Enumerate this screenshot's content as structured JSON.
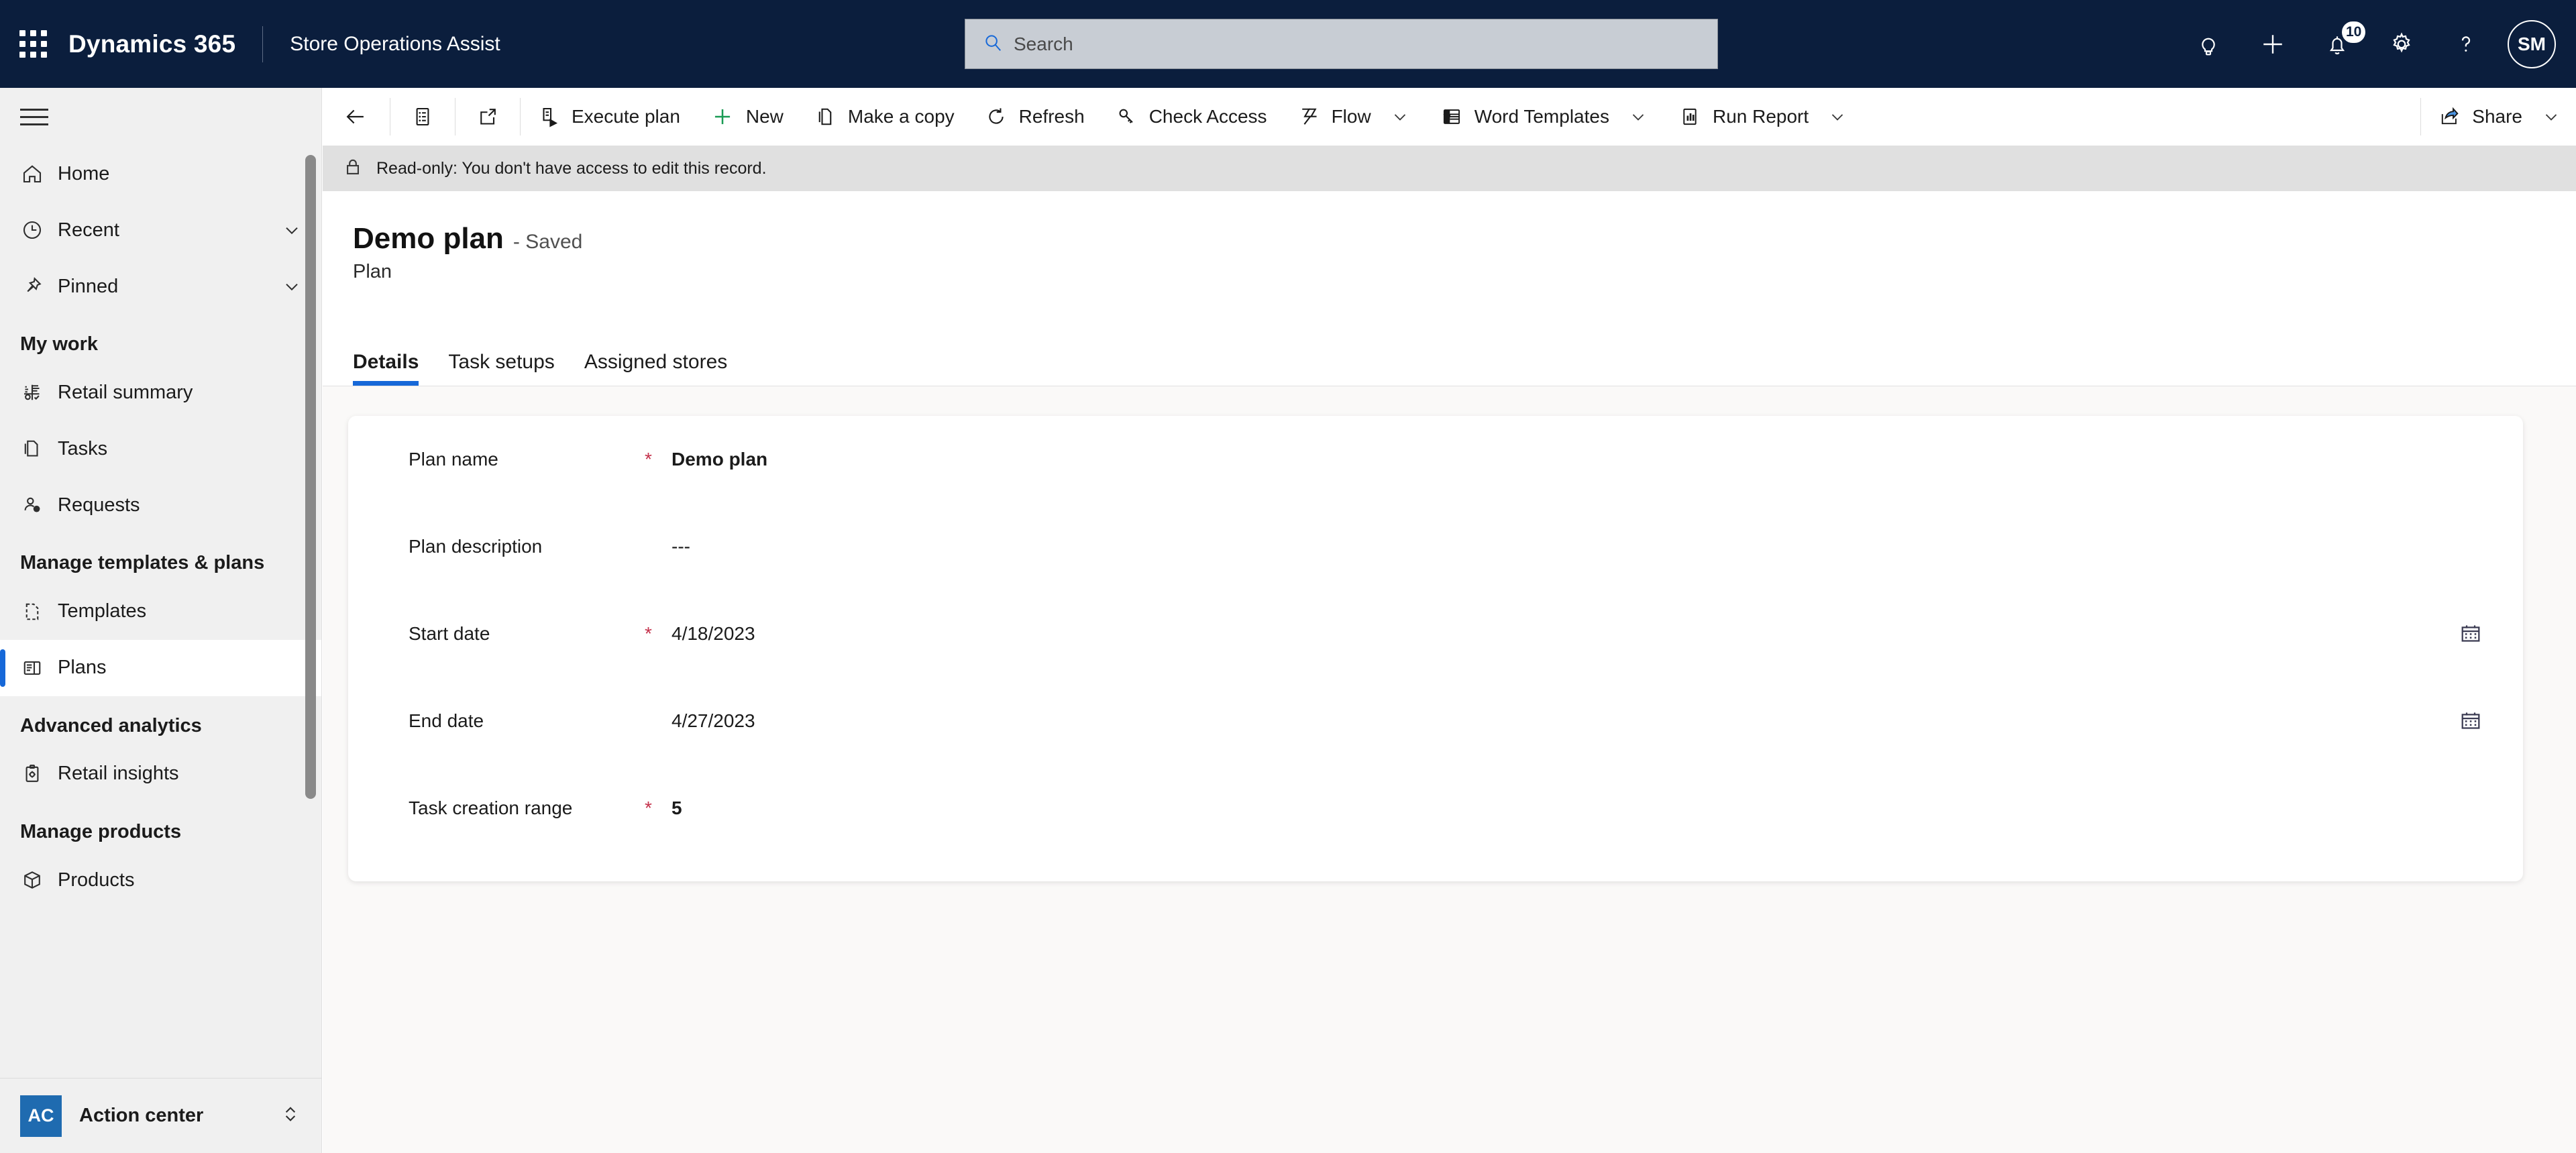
{
  "header": {
    "waffle_icon": "app-launcher-icon",
    "brand": "Dynamics 365",
    "app": "Store Operations Assist",
    "search": {
      "placeholder": "Search",
      "value": "",
      "icon": "search-icon"
    },
    "right_icons": [
      {
        "name": "lightbulb-icon",
        "label": ""
      },
      {
        "name": "add-icon",
        "label": ""
      },
      {
        "name": "notifications-bell-icon",
        "label": "",
        "badge": "10"
      },
      {
        "name": "settings-gear-icon",
        "label": ""
      },
      {
        "name": "help-question-icon",
        "label": ""
      }
    ],
    "avatar_initials": "SM",
    "colors": {
      "header_bg": "#0b1e3d",
      "accent": "#1668d8"
    }
  },
  "sidebar": {
    "hamburger_icon": "hamburger-menu-icon",
    "items": [
      {
        "type": "item",
        "label": "Home",
        "icon": "home-icon",
        "chevron": false,
        "selected": false
      },
      {
        "type": "item",
        "label": "Recent",
        "icon": "clock-icon",
        "chevron": true,
        "selected": false
      },
      {
        "type": "item",
        "label": "Pinned",
        "icon": "pin-icon",
        "chevron": true,
        "selected": false
      },
      {
        "type": "group",
        "label": "My work"
      },
      {
        "type": "item",
        "label": "Retail summary",
        "icon": "chart-summary-icon",
        "chevron": false,
        "selected": false
      },
      {
        "type": "item",
        "label": "Tasks",
        "icon": "documents-icon",
        "chevron": false,
        "selected": false
      },
      {
        "type": "item",
        "label": "Requests",
        "icon": "person-question-icon",
        "chevron": false,
        "selected": false
      },
      {
        "type": "group",
        "label": "Manage templates & plans"
      },
      {
        "type": "item",
        "label": "Templates",
        "icon": "template-page-icon",
        "chevron": false,
        "selected": false
      },
      {
        "type": "item",
        "label": "Plans",
        "icon": "plans-layout-icon",
        "chevron": false,
        "selected": true
      },
      {
        "type": "group",
        "label": "Advanced analytics"
      },
      {
        "type": "item",
        "label": "Retail insights",
        "icon": "clipboard-gear-icon",
        "chevron": false,
        "selected": false
      },
      {
        "type": "group",
        "label": "Manage products"
      },
      {
        "type": "item",
        "label": "Products",
        "icon": "box-package-icon",
        "chevron": false,
        "selected": false
      }
    ],
    "footer": {
      "badge": "AC",
      "label": "Action center",
      "chevron_icon": "chevron-up-down-icon"
    }
  },
  "command_bar": {
    "back_icon": "back-arrow-icon",
    "form_selector_icon": "form-list-icon",
    "popout_icon": "open-in-new-window-icon",
    "buttons": [
      {
        "label": "Execute plan",
        "icon": "execute-plan-icon",
        "chevron": false
      },
      {
        "label": "New",
        "icon": "add-green-icon",
        "chevron": false
      },
      {
        "label": "Make a copy",
        "icon": "copy-icon",
        "chevron": false
      },
      {
        "label": "Refresh",
        "icon": "refresh-icon",
        "chevron": false
      },
      {
        "label": "Check Access",
        "icon": "key-icon",
        "chevron": false
      },
      {
        "label": "Flow",
        "icon": "flow-icon",
        "chevron": true
      },
      {
        "label": "Word Templates",
        "icon": "word-icon",
        "chevron": true
      },
      {
        "label": "Run Report",
        "icon": "report-icon",
        "chevron": true
      }
    ],
    "share": {
      "label": "Share",
      "icon": "share-icon",
      "chevron": true
    }
  },
  "banner": {
    "icon": "lock-icon",
    "text": "Read-only: You don't have access to edit this record."
  },
  "record": {
    "title": "Demo plan",
    "saved_state": "- Saved",
    "entity": "Plan",
    "tabs": [
      {
        "label": "Details",
        "active": true
      },
      {
        "label": "Task setups",
        "active": false
      },
      {
        "label": "Assigned stores",
        "active": false
      }
    ]
  },
  "form": {
    "fields": [
      {
        "label": "Plan name",
        "required": true,
        "value": "Demo plan",
        "bold": true,
        "calendar": false
      },
      {
        "label": "Plan description",
        "required": false,
        "value": "---",
        "bold": false,
        "calendar": false
      },
      {
        "label": "Start date",
        "required": true,
        "value": "4/18/2023",
        "bold": false,
        "calendar": true
      },
      {
        "label": "End date",
        "required": false,
        "value": "4/27/2023",
        "bold": false,
        "calendar": true
      },
      {
        "label": "Task creation range",
        "required": true,
        "value": "5",
        "bold": true,
        "calendar": false
      }
    ],
    "required_marker": "*",
    "calendar_icon": "calendar-icon"
  }
}
